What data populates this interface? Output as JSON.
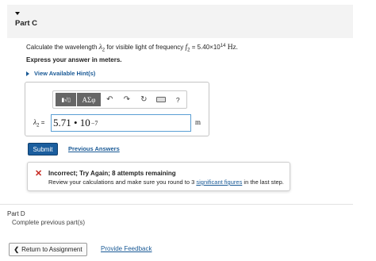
{
  "part_c": {
    "title": "Part C",
    "question_prefix": "Calculate the wavelength",
    "question_lambda": "λ",
    "question_lambda_sub": "2",
    "question_mid": "for visible light of frequency",
    "question_f": "f",
    "question_f_sub": "2",
    "question_eq": "= 5.40×10",
    "question_exp": "14",
    "question_unit": "Hz",
    "question_end": ".",
    "instruction": "Express your answer in meters.",
    "hints_label": "View Available Hint(s)"
  },
  "toolbar": {
    "template_label": "▮√▯",
    "symbols_label": "ΑΣφ",
    "undo_glyph": "↶",
    "redo_glyph": "↷",
    "reset_glyph": "↻",
    "help_glyph": "?"
  },
  "answer": {
    "label_var": "λ",
    "label_sub": "2",
    "label_eq": " =",
    "value": "5.71 • 10",
    "exponent": "−7",
    "unit": "m"
  },
  "actions": {
    "submit_label": "Submit",
    "previous_answers_label": "Previous Answers"
  },
  "feedback": {
    "icon": "✕",
    "title": "Incorrect; Try Again; 8 attempts remaining",
    "detail_before": "Review your calculations and make sure you round to 3",
    "detail_link": "significant figures",
    "detail_after": "in the last step."
  },
  "part_d": {
    "title": "Part D",
    "subtitle": "Complete previous part(s)"
  },
  "footer": {
    "return_chevron": "❮",
    "return_label": "Return to Assignment",
    "feedback_label": "Provide Feedback"
  },
  "colors": {
    "link": "#1a5a96",
    "submit": "#1b5e9e",
    "error": "#c6261e",
    "toolbar_button": "#666666",
    "input_border": "#5a9fd4"
  }
}
